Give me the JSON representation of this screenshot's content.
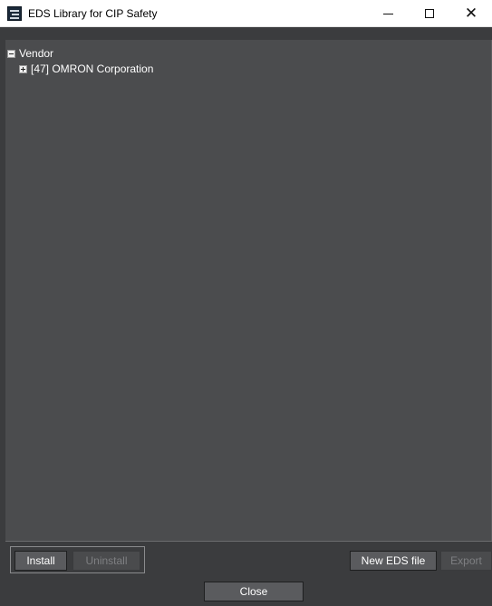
{
  "window": {
    "title": "EDS Library for CIP Safety",
    "min_glyph": "—",
    "max_glyph": "☐",
    "close_glyph": "✕"
  },
  "tree": {
    "root": {
      "label": "Vendor",
      "expanded": true
    },
    "children": [
      {
        "label": "[47] OMRON Corporation",
        "expanded": false
      }
    ]
  },
  "buttons": {
    "install": "Install",
    "uninstall": "Uninstall",
    "new_eds_file": "New EDS file",
    "export": "Export",
    "close": "Close"
  },
  "colors": {
    "background": "#3b3c3e",
    "tree_background": "#4b4c4e",
    "button_enabled": "#5a5b5e",
    "text": "#ffffff",
    "disabled_text": "#7e7f82"
  }
}
